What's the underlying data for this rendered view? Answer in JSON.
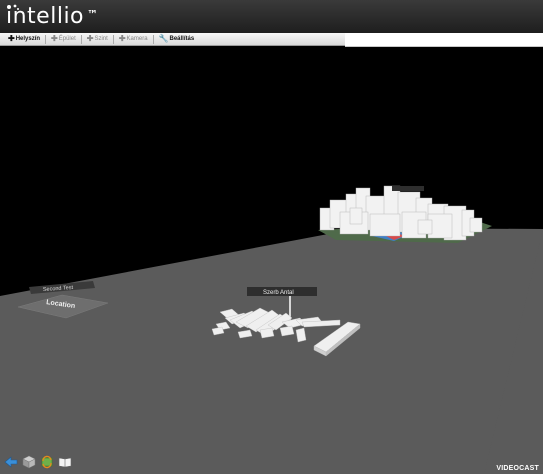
{
  "app": {
    "logo_text": "intellio",
    "logo_tm": "™"
  },
  "toolbar": {
    "buttons": [
      {
        "label": "Helyszín",
        "icon": "plus-icon",
        "active": true
      },
      {
        "label": "Épület",
        "icon": "plus-icon",
        "active": false
      },
      {
        "label": "Szint",
        "icon": "plus-icon",
        "active": false
      },
      {
        "label": "Kamera",
        "icon": "plus-icon",
        "active": false
      },
      {
        "label": "Beállítás",
        "icon": "wrench-icon",
        "active": true
      }
    ]
  },
  "scene": {
    "labels": {
      "second_test": "Second Test",
      "location": "Location",
      "szerb_antal": "Szerb Antal"
    },
    "colors": {
      "ground": "#5a5a5a",
      "background": "#000000",
      "buildings": "#f0f0f0"
    }
  },
  "bottom_toolbar": {
    "icons": [
      "back-arrow-icon",
      "layers-cube-icon",
      "refresh-map-icon",
      "book-icon"
    ]
  },
  "watermark": "VIDEOCAST"
}
